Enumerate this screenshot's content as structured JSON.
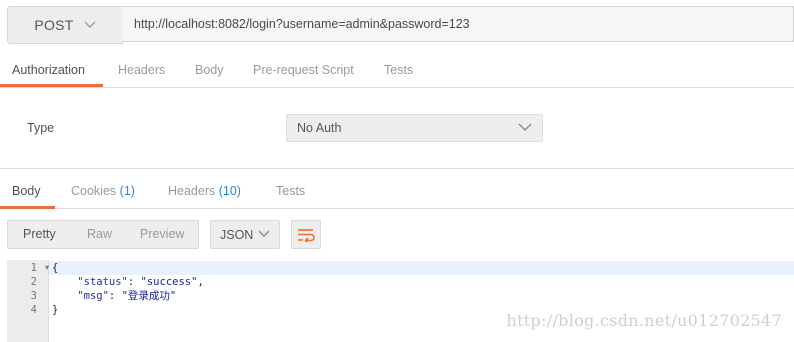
{
  "request": {
    "method": "POST",
    "url": "http://localhost:8082/login?username=admin&password=123"
  },
  "request_tabs": [
    "Authorization",
    "Headers",
    "Body",
    "Pre-request Script",
    "Tests"
  ],
  "auth": {
    "type_label": "Type",
    "selected": "No Auth"
  },
  "response_tabs": {
    "body": "Body",
    "cookies": "Cookies",
    "cookies_count": "(1)",
    "headers": "Headers",
    "headers_count": "(10)",
    "tests": "Tests"
  },
  "toolbar": {
    "views": [
      "Pretty",
      "Raw",
      "Preview"
    ],
    "format": "JSON"
  },
  "code": {
    "line_numbers": [
      "1",
      "2",
      "3",
      "4"
    ],
    "open_brace": "{",
    "close_brace": "}",
    "status_key": "\"status\"",
    "status_value": "\"success\"",
    "msg_key": "\"msg\"",
    "msg_value": "\"登录成功\""
  },
  "watermark": "http://blog.csdn.net/u012702547",
  "colors": {
    "accent": "#f26b3a",
    "count_blue": "#2c86d1"
  },
  "icons": [
    "chevron-down-icon",
    "wrap-lines-icon"
  ]
}
